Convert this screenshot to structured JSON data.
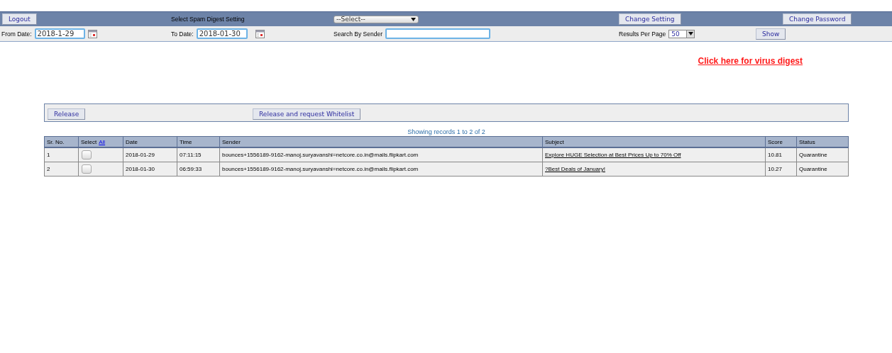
{
  "toolbar": {
    "logout": "Logout",
    "digest_label": "Select Spam Digest Setting",
    "digest_select": "--Select--",
    "change_setting": "Change Setting",
    "change_password": "Change Password"
  },
  "filters": {
    "from_label": "From Date:",
    "from_value": "2018-1-29",
    "to_label": "To Date:",
    "to_value": "2018-01-30",
    "search_label": "Search By Sender",
    "results_label": "Results Per Page",
    "results_value": "50",
    "show": "Show"
  },
  "virus_link": "Click here for virus digest",
  "actions": [
    "Release",
    "Release and request Whitelist"
  ],
  "records_info": "Showing records 1 to 2 of 2",
  "table": {
    "columns": [
      {
        "label": "Sr. No.",
        "kind": "text"
      },
      {
        "label": "Select",
        "kind": "select",
        "link": "All"
      },
      {
        "label": "Date",
        "kind": "text"
      },
      {
        "label": "Time",
        "kind": "text"
      },
      {
        "label": "Sender",
        "kind": "text"
      },
      {
        "label": "Subject",
        "kind": "link"
      },
      {
        "label": "Score",
        "kind": "text"
      },
      {
        "label": "Status",
        "kind": "text"
      }
    ],
    "rows": [
      {
        "sr": "1",
        "checked": false,
        "date": "2018-01-29",
        "time": "07:11:15",
        "sender": "bounces+1556189-9162-manoj.suryavanshi=netcore.co.in@mails.flipkart.com",
        "subject": "Explore HUGE Selection at Best Prices Up to 70% Off",
        "score": "10.81",
        "status": "Quarantine"
      },
      {
        "sr": "2",
        "checked": false,
        "date": "2018-01-30",
        "time": "06:59:33",
        "sender": "bounces+1556189-9162-manoj.suryavanshi=netcore.co.in@mails.flipkart.com",
        "subject": "?Best Deals of January!",
        "score": "10.27",
        "status": "Quarantine"
      }
    ]
  }
}
